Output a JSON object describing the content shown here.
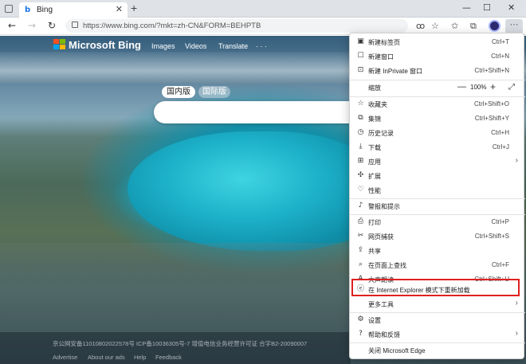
{
  "tab": {
    "title": "Bing",
    "favicon": "b"
  },
  "address_bar": {
    "url": "https://www.bing.com/?mkt=zh-CN&FORM=BEHPTB"
  },
  "bing": {
    "logo_text": "Microsoft Bing",
    "nav": [
      "Images",
      "Videos",
      "Translate",
      "· · ·"
    ],
    "toggle_on": "国内版",
    "toggle_off": "国际版"
  },
  "footer": {
    "line1": "京公网安备11010802022578号   ICP备10036305号-7   增值电信业务经营许可证 合字B2-20090007",
    "line2_items": [
      "Advertise",
      "About our ads",
      "Help",
      "Feedback"
    ]
  },
  "menu": {
    "items": [
      {
        "label": "新建标签页",
        "shortcut": "Ctrl+T",
        "icon": "new-tab-icon"
      },
      {
        "label": "新建窗口",
        "shortcut": "Ctrl+N",
        "icon": "new-window-icon"
      },
      {
        "label": "新建 InPrivate 窗口",
        "shortcut": "Ctrl+Shift+N",
        "icon": "inprivate-icon"
      },
      {
        "label": "收藏夹",
        "shortcut": "Ctrl+Shift+O",
        "icon": "favorites-icon"
      },
      {
        "label": "集锦",
        "shortcut": "Ctrl+Shift+Y",
        "icon": "collections-icon"
      },
      {
        "label": "历史记录",
        "shortcut": "Ctrl+H",
        "icon": "history-icon"
      },
      {
        "label": "下载",
        "shortcut": "Ctrl+J",
        "icon": "download-icon"
      },
      {
        "label": "应用",
        "shortcut": "",
        "icon": "apps-icon"
      },
      {
        "label": "扩展",
        "shortcut": "",
        "icon": "extensions-icon"
      },
      {
        "label": "性能",
        "shortcut": "",
        "icon": "performance-icon"
      },
      {
        "label": "警报和提示",
        "shortcut": "",
        "icon": "bell-icon"
      },
      {
        "label": "打印",
        "shortcut": "Ctrl+P",
        "icon": "print-icon"
      },
      {
        "label": "网页捕获",
        "shortcut": "Ctrl+Shift+S",
        "icon": "capture-icon"
      },
      {
        "label": "共享",
        "shortcut": "",
        "icon": "share-icon"
      },
      {
        "label": "在页面上查找",
        "shortcut": "Ctrl+F",
        "icon": "find-icon"
      },
      {
        "label": "大声朗读",
        "shortcut": "Ctrl+Shift+U",
        "icon": "read-aloud-icon"
      },
      {
        "label": "在 Internet Explorer 模式下重新加载",
        "shortcut": "",
        "icon": "ie-mode-icon"
      },
      {
        "label": "更多工具",
        "shortcut": "",
        "icon": ""
      },
      {
        "label": "设置",
        "shortcut": "",
        "icon": "gear-icon"
      },
      {
        "label": "帮助和反馈",
        "shortcut": "",
        "icon": "help-icon"
      },
      {
        "label": "关闭 Microsoft Edge",
        "shortcut": "",
        "icon": ""
      }
    ],
    "zoom": {
      "label": "缩放",
      "value": "100%",
      "minus": "—",
      "plus": "+"
    }
  },
  "colors": {
    "highlight": "#e02020",
    "tab_strip": "#dfe3e8"
  }
}
